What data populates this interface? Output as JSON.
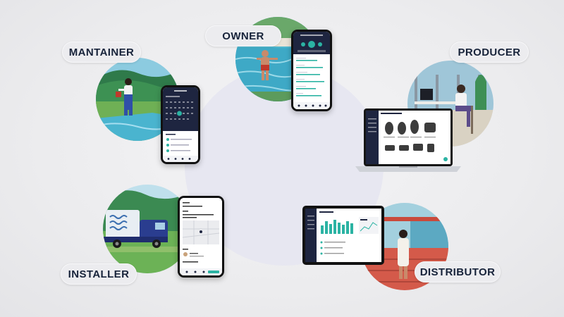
{
  "roles": {
    "owner": "OWNER",
    "maintainer": "MANTAINER",
    "producer": "PRODUCER",
    "installer": "INSTALLER",
    "distributor": "DISTRIBUTOR"
  },
  "colors": {
    "background": "#ececee",
    "center_circle": "#e7e7f1",
    "pill_text": "#17233a",
    "app_dark": "#1e2540",
    "app_accent": "#2bb3a3"
  }
}
